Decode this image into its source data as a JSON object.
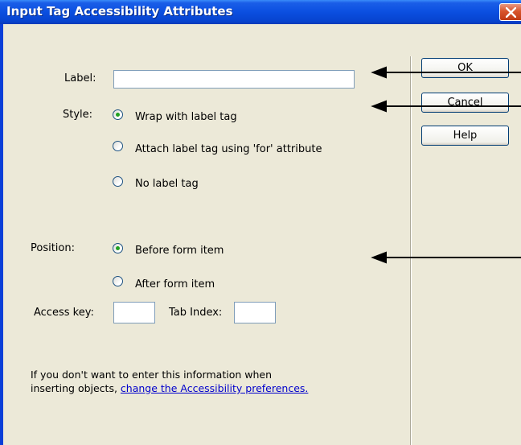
{
  "window": {
    "title": "Input Tag Accessibility Attributes"
  },
  "form": {
    "label_caption": "Label:",
    "label_value": "",
    "style_caption": "Style:",
    "style_options": [
      "Wrap with label tag",
      "Attach label tag using 'for' attribute",
      "No label tag"
    ],
    "style_selected": "Wrap with label tag",
    "position_caption": "Position:",
    "position_options": [
      "Before form item",
      "After form item"
    ],
    "position_selected": "Before form item",
    "access_key_caption": "Access key:",
    "access_key_value": "",
    "tab_index_caption": "Tab Index:",
    "tab_index_value": ""
  },
  "buttons": {
    "ok": "OK",
    "cancel": "Cancel",
    "help": "Help"
  },
  "footer": {
    "line1": "If you don't want to enter this information when",
    "line2_prefix": "inserting objects, ",
    "link": "change the Accessibility preferences."
  },
  "colors": {
    "title_bar": "#0b4fe0",
    "dialog_bg": "#ece9d8",
    "radio_dot": "#21a121",
    "link": "#0000cc"
  }
}
